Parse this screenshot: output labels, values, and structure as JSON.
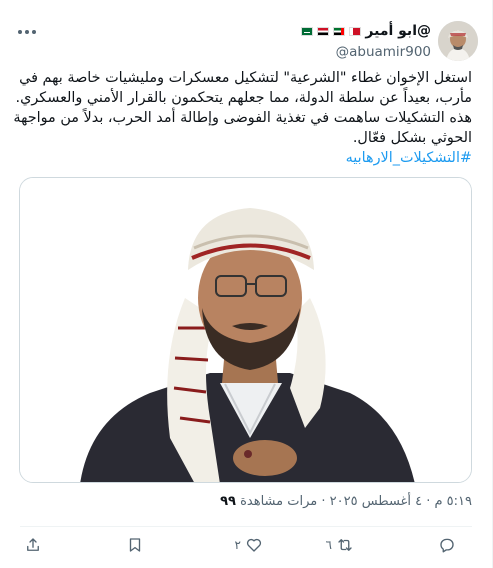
{
  "author": {
    "display_name": "@ابو أمير",
    "handle": "@abuamir900",
    "flags": [
      "bahrain-flag",
      "uae-flag",
      "egypt-flag",
      "saudi-flag"
    ]
  },
  "tweet": {
    "lines": [
      "استغل الإخوان غطاء \"الشرعية\" لتشكيل معسكرات ومليشيات خاصة بهم في",
      "مأرب، بعيداً عن سلطة الدولة، مما جعلهم يتحكمون بالقرار الأمني والعسكري.",
      "هذه التشكيلات ساهمت في تغذية الفوضى وإطالة أمد الحرب، بدلاً من مواجهة",
      "الحوثي بشكل فعّال."
    ],
    "hashtag": "#التشكيلات_الارهابيه"
  },
  "meta": {
    "timestamp": "٥:١٩ م · ٤ أغسطس ٢٠٢٥ ·",
    "views_label": "مرات مشاهدة",
    "views_count": "٩٩"
  },
  "actions": {
    "reply_count": "",
    "retweet_count": "٦",
    "like_count": "٢",
    "bookmark_count": "",
    "share_count": ""
  },
  "icons": {
    "more": "more-icon",
    "reply": "reply-icon",
    "retweet": "retweet-icon",
    "like": "heart-icon",
    "bookmark": "bookmark-icon",
    "share": "share-icon"
  },
  "colors": {
    "text": "#0f1419",
    "secondary": "#536471",
    "link": "#1d9bf0",
    "border": "#eff3f4"
  }
}
